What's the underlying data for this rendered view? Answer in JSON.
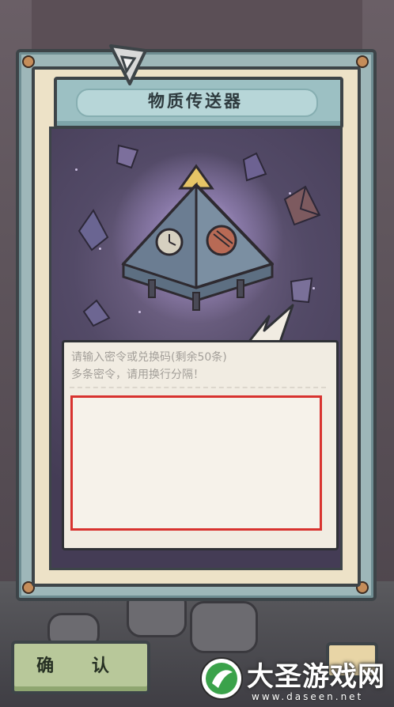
{
  "title": "物质传送器",
  "input": {
    "hint_line1": "请输入密令或兑换码(剩余50条)",
    "hint_line2": "多条密令，请用换行分隔！",
    "value": ""
  },
  "buttons": {
    "confirm_label": "确 认"
  },
  "watermark": {
    "title": "大圣游戏网",
    "url": "www.daseen.net"
  },
  "colors": {
    "frame": "#9eb7b9",
    "card": "#ede2c7",
    "title_banner": "#9cc0c3",
    "scene": "#534a67",
    "input_border": "#d8332f",
    "confirm_button": "#b8c89a"
  },
  "icons": [
    "pyramid-transporter-icon",
    "crystal-shard-icon",
    "game-logo-icon",
    "watermark-logo-icon"
  ]
}
